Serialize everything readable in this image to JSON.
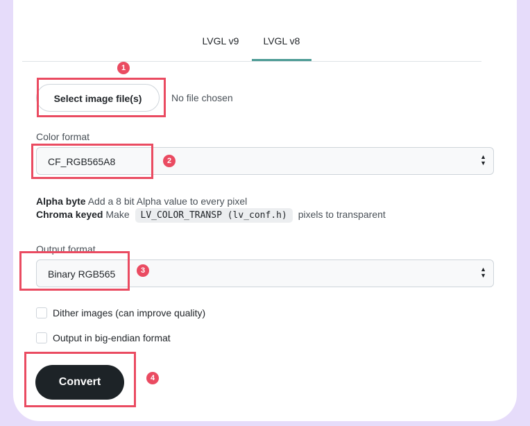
{
  "tabs": [
    {
      "label": "LVGL v9"
    },
    {
      "label": "LVGL v8",
      "active": true
    }
  ],
  "file": {
    "button_label": "Select image file(s)",
    "status": "No file chosen"
  },
  "color_format": {
    "label": "Color format",
    "selected": "CF_RGB565A8"
  },
  "info": {
    "alpha_title": "Alpha byte",
    "alpha_text": "Add a 8 bit Alpha value to every pixel",
    "chroma_title": "Chroma keyed",
    "chroma_pre": "Make",
    "chroma_code": "LV_COLOR_TRANSP (lv_conf.h)",
    "chroma_post": "pixels to transparent"
  },
  "output_format": {
    "label": "Output format",
    "selected": "Binary RGB565"
  },
  "options": {
    "dither_label": "Dither images (can improve quality)",
    "big_endian_label": "Output in big-endian format"
  },
  "convert_label": "Convert",
  "annotations": [
    "1",
    "2",
    "3",
    "4"
  ],
  "colors": {
    "accent": "#4a9a93",
    "highlight": "#ea4b61",
    "button": "#1d2327"
  }
}
